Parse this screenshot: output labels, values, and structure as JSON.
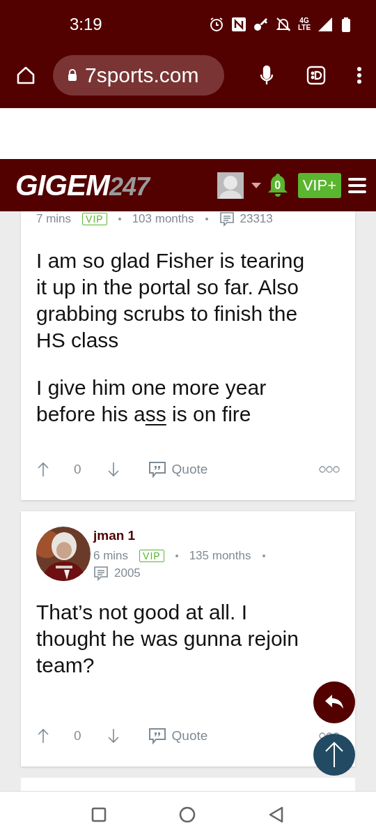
{
  "status_bar": {
    "time": "3:19",
    "network": "4G LTE"
  },
  "browser": {
    "url": "7sports.com"
  },
  "site_header": {
    "logo": {
      "primary": "GIGEM",
      "secondary": "247"
    },
    "notifications": "0",
    "vip_button": "VIP+"
  },
  "posts": [
    {
      "time": "7 mins",
      "badge": "VIP",
      "tenure": "103 months",
      "post_count": "23313",
      "paragraphs": [
        [
          {
            "text": "I am so glad Fisher is tearing it up in the portal so far. Also grabbing scrubs to finish the HS class",
            "underlined": false
          }
        ],
        [
          {
            "text": "I give him one more year before his a",
            "underlined": false
          },
          {
            "text": "ss",
            "underlined": true
          },
          {
            "text": " is on fire",
            "underlined": false
          }
        ]
      ],
      "votes": "0",
      "quote": "Quote"
    },
    {
      "author": "jman 1",
      "avatar": {
        "kind": "picture"
      },
      "time": "6 mins",
      "badge": "VIP",
      "tenure": "135 months",
      "post_count": "2005",
      "paragraphs": [
        [
          {
            "text": "That’s not good at all. I thought he was gunna rejoin team?",
            "underlined": false
          }
        ]
      ],
      "votes": "0",
      "quote": "Quote"
    }
  ]
}
